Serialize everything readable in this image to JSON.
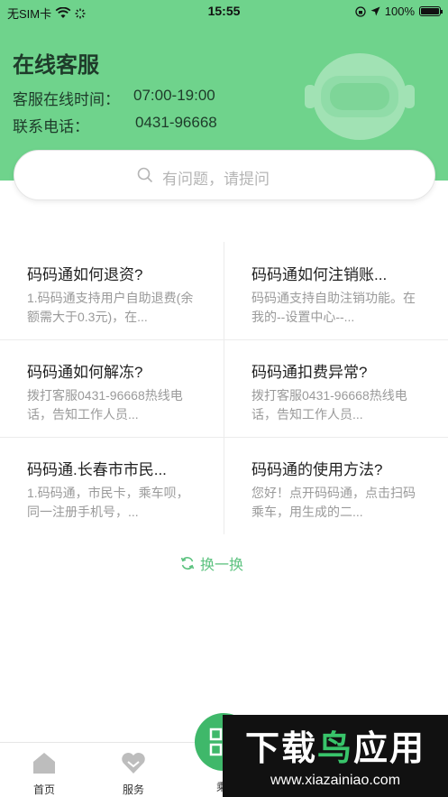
{
  "status_bar": {
    "carrier": "无SIM卡",
    "time": "15:55",
    "battery": "100%"
  },
  "header": {
    "title": "在线客服",
    "hours_label": "客服在线时间：",
    "hours_value": "07:00-19:00",
    "phone_label": "联系电话：",
    "phone_value": "0431-96668"
  },
  "search": {
    "placeholder": "有问题，请提问"
  },
  "faq": [
    {
      "q": "码码通如何退资?",
      "a": "1.码码通支持用户自助退费(余额需大于0.3元)，在..."
    },
    {
      "q": "码码通如何注销账...",
      "a": "码码通支持自助注销功能。在我的--设置中心--..."
    },
    {
      "q": "码码通如何解冻?",
      "a": "拨打客服0431-96668热线电话，告知工作人员..."
    },
    {
      "q": "码码通扣费异常?",
      "a": "拨打客服0431-96668热线电话，告知工作人员..."
    },
    {
      "q": "码码通.长春市市民...",
      "a": "1.码码通，市民卡，乘车呗，同一注册手机号，..."
    },
    {
      "q": "码码通的使用方法?",
      "a": "您好！点开码码通，点击扫码乘车，用生成的二..."
    }
  ],
  "refresh_label": "换一换",
  "tabbar": {
    "home": "首页",
    "service": "服务",
    "ride": "乘"
  },
  "watermark": {
    "title_white": "下载",
    "title_green": "鸟",
    "title_white2": "应用",
    "url": "www.xiazainiao.com"
  },
  "colors": {
    "header_bg": "#6fd38c",
    "accent": "#5cc27f"
  }
}
